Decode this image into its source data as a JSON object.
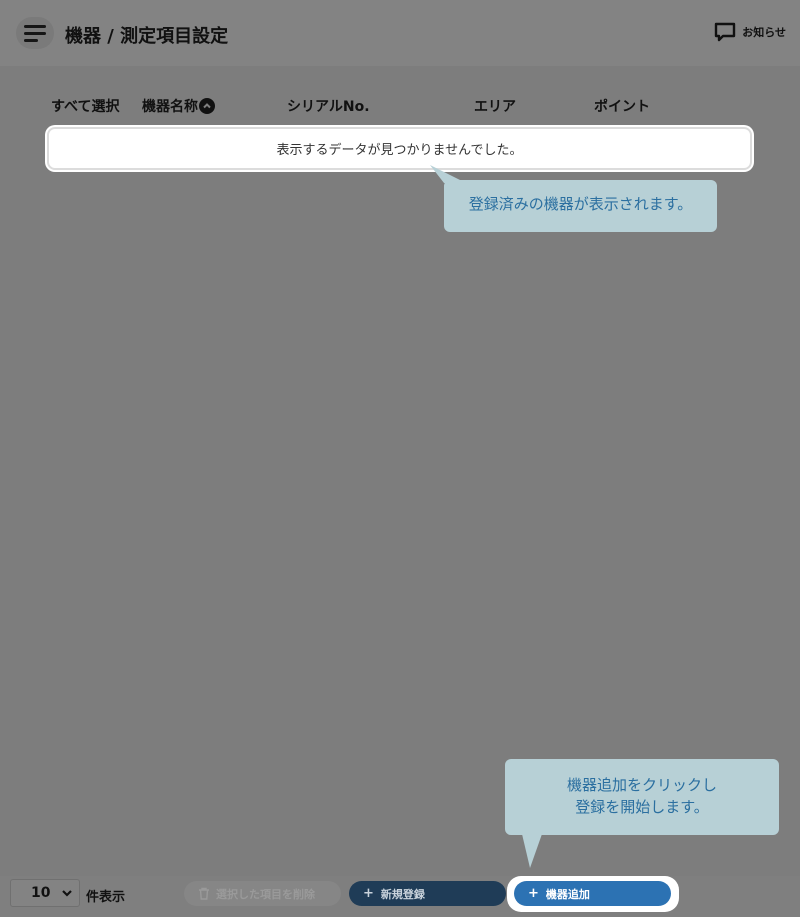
{
  "header": {
    "title": "機器 / 測定項目設定",
    "notice_label": "お知らせ",
    "menu_icon": "hamburger-icon",
    "notice_icon": "chat-bubble-icon"
  },
  "table": {
    "columns": [
      "すべて選択",
      "機器名称",
      "シリアルNo.",
      "エリア",
      "ポイント"
    ],
    "sort_icon": "chevron-up-circle-icon",
    "empty_message": "表示するデータが見つかりませんでした。"
  },
  "tooltips": {
    "list_hint": "登録済みの機器が表示されます。",
    "add_hint_line1": "機器追加をクリックし",
    "add_hint_line2": "登録を開始します。"
  },
  "footer": {
    "page_size_value": "10",
    "page_size_label": "件表示",
    "delete_label": "選択した項目を削除",
    "new_label": "新規登録",
    "add_label": "機器追加"
  },
  "colors": {
    "overlay": "#7f7f7f",
    "tooltip_bg": "#b7d0d6",
    "tooltip_text": "#2b6fa0",
    "add_button": "#2c72b3",
    "new_button": "#1f3c57"
  }
}
